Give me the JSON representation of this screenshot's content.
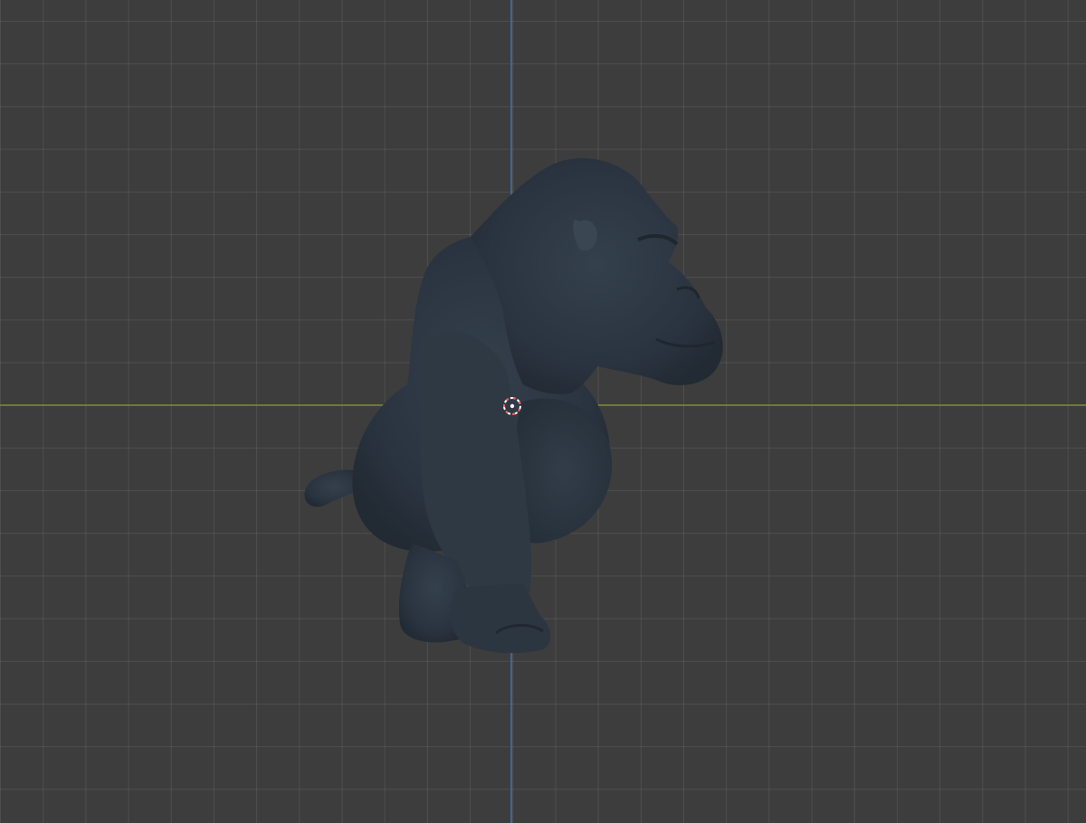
{
  "viewport": {
    "mode": "3D viewport",
    "background_color": "#3d3d3d",
    "grid_color": "#555555",
    "x_axis_color": "#8a9a3a",
    "y_axis_color": "#4a6fb0"
  },
  "scene": {
    "object": "gorilla-model",
    "model_color": "#2b3540",
    "cursor_color": "#ff5a5a"
  },
  "icons": {
    "cursor": "3d-cursor-icon"
  }
}
